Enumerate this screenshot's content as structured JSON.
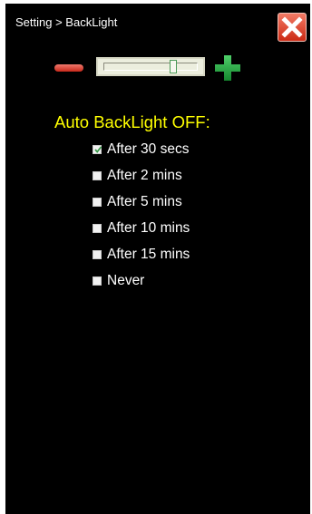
{
  "header": {
    "breadcrumb": "Setting > BackLight",
    "close_icon": "close-x-icon"
  },
  "brightness": {
    "decrease_icon": "minus-icon",
    "increase_icon": "plus-icon",
    "level_fraction": 0.74,
    "accent_minus": "#d23020",
    "accent_plus": "#22a040"
  },
  "auto_off": {
    "heading": "Auto BackLight OFF:",
    "heading_color": "#ffff00",
    "options": [
      {
        "label": "After 30 secs",
        "checked": true
      },
      {
        "label": "After 2 mins",
        "checked": false
      },
      {
        "label": "After 5 mins",
        "checked": false
      },
      {
        "label": "After 10 mins",
        "checked": false
      },
      {
        "label": "After 15 mins",
        "checked": false
      },
      {
        "label": "Never",
        "checked": false
      }
    ]
  }
}
